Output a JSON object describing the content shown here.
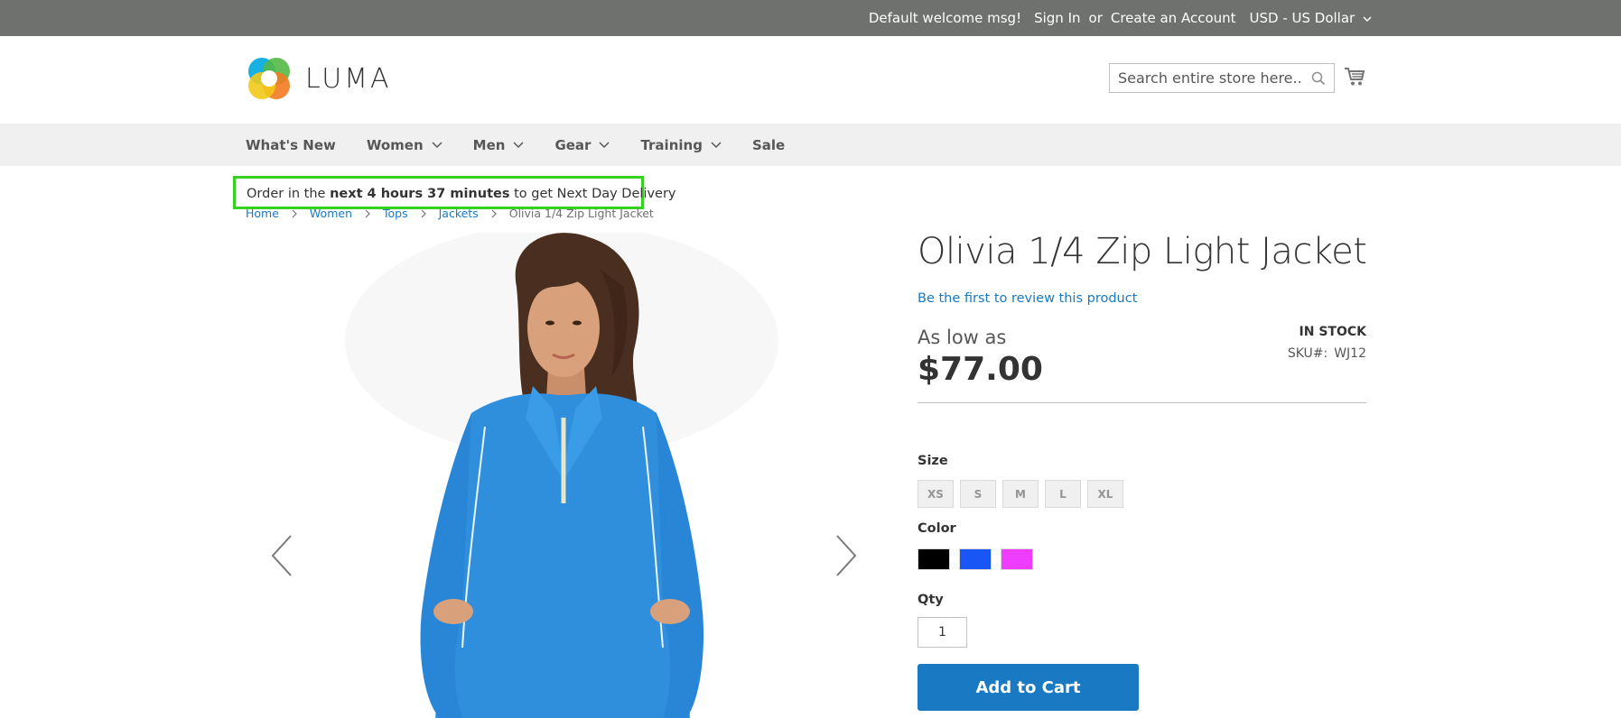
{
  "top_panel": {
    "welcome": "Default welcome msg!",
    "sign_in": "Sign In",
    "or": "or",
    "create_account": "Create an Account",
    "currency": "USD - US Dollar"
  },
  "header": {
    "logo_text": "LUMA",
    "search_placeholder": "Search entire store here...",
    "search_icon": "search-icon",
    "cart_icon": "cart-icon"
  },
  "nav": {
    "items": [
      {
        "label": "What's New",
        "has_dropdown": false
      },
      {
        "label": "Women",
        "has_dropdown": true
      },
      {
        "label": "Men",
        "has_dropdown": true
      },
      {
        "label": "Gear",
        "has_dropdown": true
      },
      {
        "label": "Training",
        "has_dropdown": true
      },
      {
        "label": "Sale",
        "has_dropdown": false
      }
    ]
  },
  "delivery": {
    "prefix": "Order in the ",
    "highlight": "next 4 hours 37 minutes",
    "suffix": " to get Next Day Delivery",
    "border_color": "#37d121"
  },
  "breadcrumbs": {
    "links": [
      "Home",
      "Women",
      "Tops",
      "Jackets"
    ],
    "current": "Olivia 1/4 Zip Light Jacket"
  },
  "product": {
    "title": "Olivia 1/4 Zip Light Jacket",
    "review_link": "Be the first to review this product",
    "price_label": "As low as",
    "price": "$77.00",
    "stock": "IN STOCK",
    "sku_label": "SKU#:",
    "sku": "WJ12",
    "size_label": "Size",
    "sizes": [
      "XS",
      "S",
      "M",
      "L",
      "XL"
    ],
    "color_label": "Color",
    "colors": [
      "#000000",
      "#1a55f5",
      "#ef3dff"
    ],
    "qty_label": "Qty",
    "qty_value": "1",
    "add_to_cart": "Add to Cart",
    "jacket_color": "#2f8fdd"
  },
  "colors": {
    "accent": "#1979c3",
    "top_panel_bg": "#6e716e",
    "nav_bg": "#f0f0f0"
  }
}
